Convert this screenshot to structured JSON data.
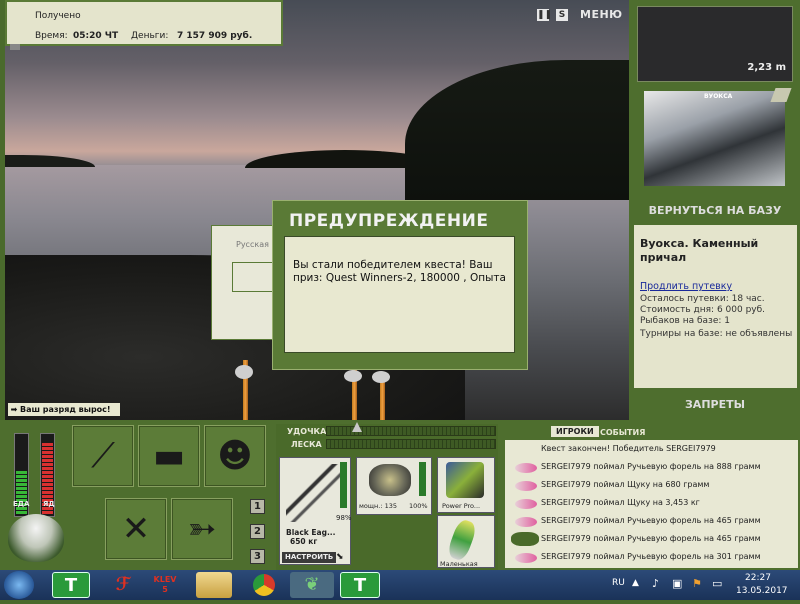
{
  "top_info": {
    "received_label": "Получено",
    "time_label": "Время:",
    "time_value": "05:20 ЧТ",
    "money_label": "Деньги:",
    "money_value": "7 157 909 руб."
  },
  "top_menu": {
    "pause_icon": "pause-icon",
    "s_label": "S",
    "menu_label": "МЕНЮ"
  },
  "sonar": {
    "depth": "2,23 m"
  },
  "map": {
    "title": "ВУОКСА"
  },
  "return_button": "ВЕРНУТЬСЯ НА БАЗУ",
  "base_info": {
    "title": "Вуокса. Каменный причал",
    "extend_link": "Продлить путевку",
    "remaining": "Осталось путевки: 18 час.",
    "day_cost": "Стоимость дня: 6 000 руб.",
    "fishers": "Рыбаков на базе: 1",
    "tournaments": "Турниры на базе: не объявлены"
  },
  "bans_button": "ЗАПРЕТЫ",
  "rank_notice": "Ваш разряд вырос!",
  "ghost_window": {
    "label": "Русская"
  },
  "dialog": {
    "title": "ПРЕДУПРЕЖДЕНИЕ",
    "message": "Вы стали победителем квеста! Ваш приз: Quest Winners-2, 180000 , Опыта"
  },
  "gauges": {
    "food_label": "ЕДА",
    "poison_label": "ЯД",
    "food_level": 0.55,
    "poison_level": 0.9
  },
  "tiles": [
    {
      "name": "rod-tile",
      "icon": "fishing-rod-icon"
    },
    {
      "name": "tacklebox-tile",
      "icon": "tackle-box-icon"
    },
    {
      "name": "fisherman-tile",
      "icon": "fisherman-icon"
    },
    {
      "name": "food-tile",
      "icon": "fork-knife-icon"
    },
    {
      "name": "fish-tile",
      "icon": "fish-icon"
    }
  ],
  "slots": [
    "1",
    "2",
    "3"
  ],
  "tackle": {
    "rod_label": "УДОЧКА",
    "line_label": "ЛЕСКА",
    "rod_name": "Black Eag...",
    "rod_weight": "650 кг",
    "rod_percent": "98%",
    "setup_button": "НАСТРОИТЬ",
    "reel_power": "мощн.: 135",
    "reel_percent": "100%",
    "line_name": "Power Pro...",
    "lure_name": "Маленькая"
  },
  "chat": {
    "tab_players": "ИГРОКИ",
    "tab_events": "СОБЫТИЯ",
    "lines": [
      "Квест закончен! Победитель SERGEI7979",
      "SERGEI7979 поймал Ручьевую форель на 888 грамм",
      "SERGEI7979 поймал Щуку на 680 грамм",
      "SERGEI7979 поймал Щуку на 3,453 кг",
      "SERGEI7979 поймал Ручьевую форель на 465 грамм",
      "SERGEI7979 поймал Ручьевую форель на 465 грамм",
      "SERGEI7979 поймал Ручьевую форель на 301 грамм"
    ]
  },
  "taskbar": {
    "klev_label": "KLEV",
    "klev_num": "5",
    "lang": "RU",
    "time": "22:27",
    "date": "13.05.2017"
  },
  "colors": {
    "panel": "#5a7a36",
    "cream": "#e8e8d0",
    "taskbar": "#1f3a66"
  }
}
